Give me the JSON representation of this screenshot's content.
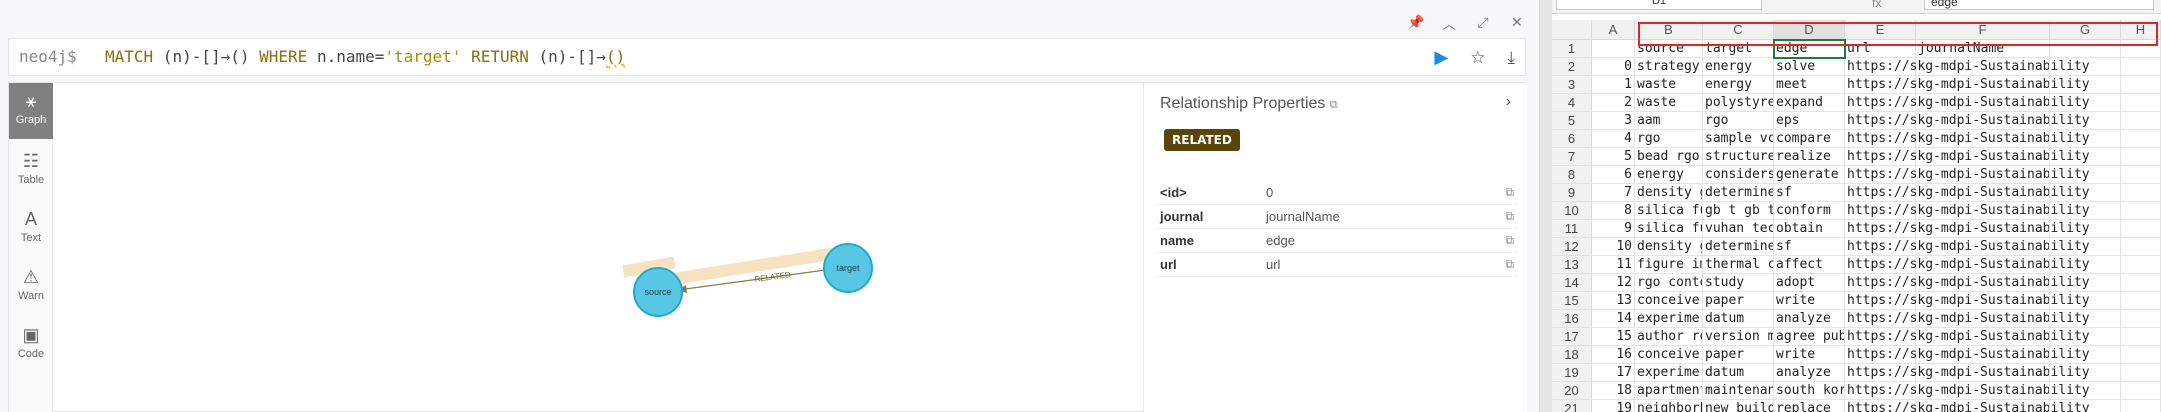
{
  "neo4j": {
    "window_controls": [
      "📌",
      "︿",
      "⤢",
      "✕"
    ],
    "prompt": "neo4j$",
    "query_parts": {
      "k1": "MATCH",
      "p1": " (n)-[]→() ",
      "k2": "WHERE",
      "p2": " n.name=",
      "s1": "'target'",
      "k3": " RETURN",
      "p3": " (n)-[]→",
      "sq": "()"
    },
    "sidebar": [
      {
        "icon": "⚹",
        "label": "Graph"
      },
      {
        "icon": "☷",
        "label": "Table"
      },
      {
        "icon": "A",
        "label": "Text"
      },
      {
        "icon": "⚠",
        "label": "Warn"
      },
      {
        "icon": "▣",
        "label": "Code"
      }
    ],
    "graph": {
      "source_label": "source",
      "target_label": "target",
      "rel_label": "RELATED",
      "node_color": "#57c7e3",
      "rel_highlight": "#f6e2c0"
    },
    "props": {
      "title": "Relationship Properties",
      "title_icon": "⧉",
      "badge": "RELATED",
      "rows": [
        {
          "key": "<id>",
          "value": "0"
        },
        {
          "key": "journal",
          "value": "journalName"
        },
        {
          "key": "name",
          "value": "edge"
        },
        {
          "key": "url",
          "value": "url"
        }
      ]
    }
  },
  "sheet": {
    "name_box": "D1",
    "fx": "fx",
    "formula_value": "edge",
    "columns": [
      "A",
      "B",
      "C",
      "D",
      "E",
      "F",
      "G",
      "H"
    ],
    "header_row": [
      "",
      "source",
      "target",
      "edge",
      "url",
      "journalName",
      "",
      ""
    ],
    "rows": [
      [
        "0",
        "strategy",
        "energy",
        "solve",
        "https://skg-mdpi-Sustainability"
      ],
      [
        "1",
        "waste",
        "energy",
        "meet",
        "https://skg-mdpi-Sustainability"
      ],
      [
        "2",
        "waste",
        "polystyrene",
        "expand",
        "https://skg-mdpi-Sustainability"
      ],
      [
        "3",
        "aam",
        "rgo",
        "eps",
        "https://skg-mdpi-Sustainability"
      ],
      [
        "4",
        "rgo",
        "sample vc",
        "compare",
        "https://skg-mdpi-Sustainability"
      ],
      [
        "5",
        "bead rgo",
        "structure",
        "realize",
        "https://skg-mdpi-Sustainability"
      ],
      [
        "6",
        "energy",
        "considers",
        "generate",
        "https://skg-mdpi-Sustainability"
      ],
      [
        "7",
        "density g",
        "determines",
        "sf",
        "https://skg-mdpi-Sustainability"
      ],
      [
        "8",
        "silica fu",
        "gb t gb t",
        "conform",
        "https://skg-mdpi-Sustainability"
      ],
      [
        "9",
        "silica fu",
        "vuhan tec",
        "obtain",
        "https://skg-mdpi-Sustainability"
      ],
      [
        "10",
        "density g",
        "determines",
        "sf",
        "https://skg-mdpi-Sustainability"
      ],
      [
        "11",
        "figure im",
        "thermal c",
        "affect",
        "https://skg-mdpi-Sustainability"
      ],
      [
        "12",
        "rgo conte",
        "study",
        "adopt",
        "https://skg-mdpi-Sustainability"
      ],
      [
        "13",
        "conceive",
        "paper",
        "write",
        "https://skg-mdpi-Sustainability"
      ],
      [
        "14",
        "experimer",
        "datum",
        "analyze",
        "https://skg-mdpi-Sustainability"
      ],
      [
        "15",
        "author re",
        "version m",
        "agree pub",
        "https://skg-mdpi-Sustainability"
      ],
      [
        "16",
        "conceive",
        "paper",
        "write",
        "https://skg-mdpi-Sustainability"
      ],
      [
        "17",
        "experimer",
        "datum",
        "analyze",
        "https://skg-mdpi-Sustainability"
      ],
      [
        "18",
        "apartment",
        "maintenance",
        "south kor",
        "https://skg-mdpi-Sustainability"
      ],
      [
        "19",
        "neighborh",
        "new build",
        "replace",
        "https://skg-mdpi-Sustainability"
      ]
    ]
  }
}
